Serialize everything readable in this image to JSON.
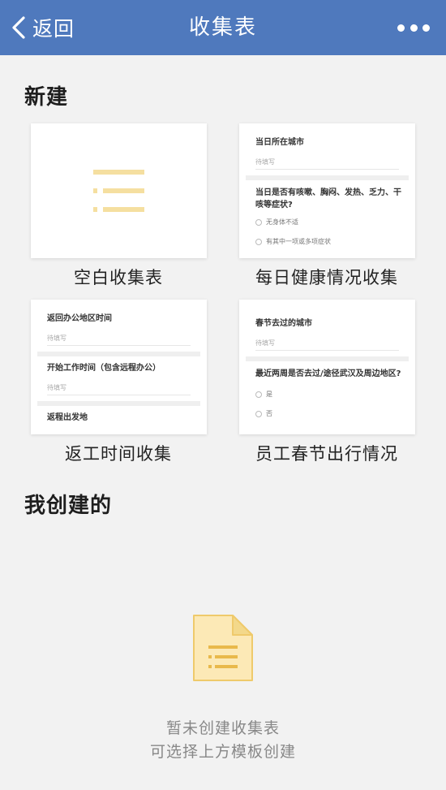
{
  "nav": {
    "back_label": "返回",
    "title": "收集表"
  },
  "sections": {
    "new_title": "新建",
    "mine_title": "我创建的"
  },
  "templates": [
    {
      "caption": "空白收集表"
    },
    {
      "caption": "每日健康情况收集",
      "preview": {
        "q1": "当日所在城市",
        "q1_placeholder": "待填写",
        "q2": "当日是否有咳嗽、胸闷、发热、乏力、干咳等症状?",
        "options": [
          "无身体不适",
          "有其中一项或多项症状"
        ]
      }
    },
    {
      "caption": "返工时间收集",
      "preview": {
        "q1": "返回办公地区时间",
        "q1_placeholder": "待填写",
        "q2": "开始工作时间（包含远程办公）",
        "q2_placeholder": "待填写",
        "q3": "返程出发地"
      }
    },
    {
      "caption": "员工春节出行情况",
      "preview": {
        "q1": "春节去过的城市",
        "q1_placeholder": "待填写",
        "q2": "最近两周是否去过/途径武汉及周边地区?",
        "options": [
          "是",
          "否"
        ]
      }
    }
  ],
  "empty_state": {
    "line1": "暂未创建收集表",
    "line2": "可选择上方模板创建"
  },
  "colors": {
    "navbar": "#4f79bd",
    "accent_yellow": "#f5dfa0",
    "background": "#f2f2f2"
  }
}
